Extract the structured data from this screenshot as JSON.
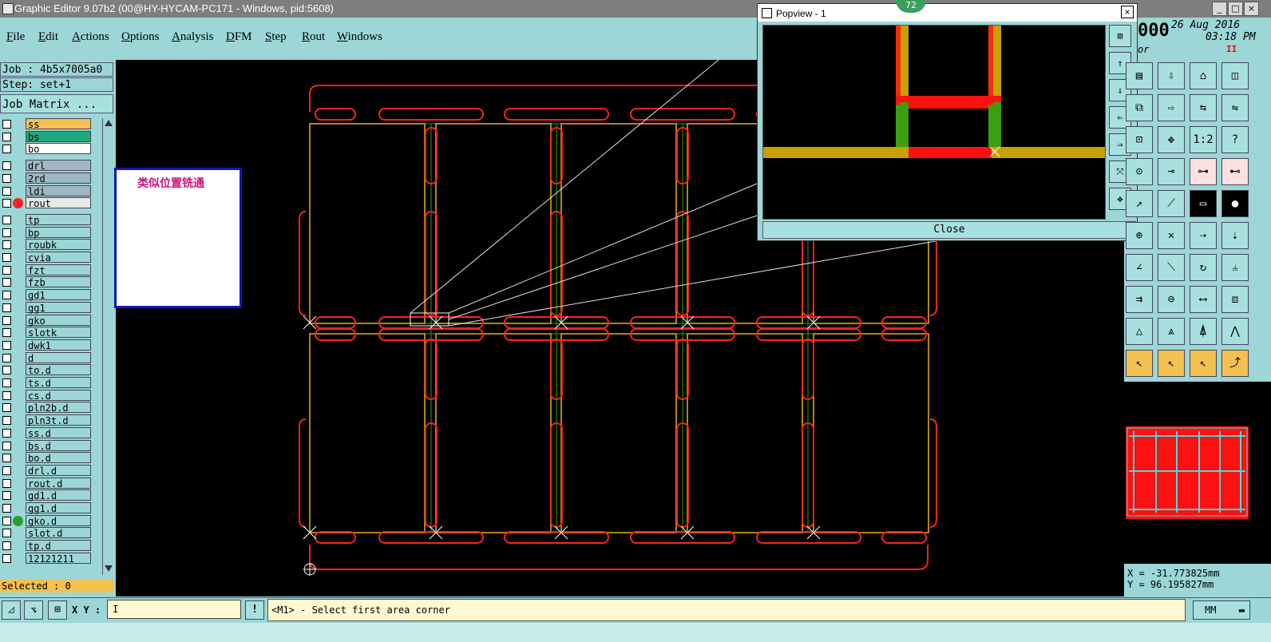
{
  "window": {
    "title": "Graphic Editor 9.07b2 (00@HY-HYCAM-PC171 - Windows, pid:5608)"
  },
  "menu": {
    "items": [
      "File",
      "Edit",
      "Actions",
      "Options",
      "Analysis",
      "DFM",
      "Step",
      "Rout",
      "Windows"
    ]
  },
  "job": {
    "label": "Job : 4b5x7005a0",
    "step": "Step: set+1",
    "matrix_button": "Job Matrix ..."
  },
  "layers": [
    {
      "name": "ss",
      "bg": "#f4c050",
      "dot": ""
    },
    {
      "name": "bs",
      "bg": "#1fa87c",
      "dot": ""
    },
    {
      "name": "bo",
      "bg": "#ffffff",
      "dot": ""
    },
    {
      "name": "drl",
      "bg": "#9fb7c2",
      "dot": ""
    },
    {
      "name": "2rd",
      "bg": "#9fb7c2",
      "dot": ""
    },
    {
      "name": "ldi",
      "bg": "#9fb7c2",
      "dot": ""
    },
    {
      "name": "rout",
      "bg": "#e8e8e8",
      "dot": "#ff2020"
    },
    {
      "name": "tp",
      "bg": "#9cd6d6",
      "dot": ""
    },
    {
      "name": "bp",
      "bg": "#9cd6d6",
      "dot": ""
    },
    {
      "name": "roubk",
      "bg": "#9cd6d6",
      "dot": ""
    },
    {
      "name": "cvia",
      "bg": "#9cd6d6",
      "dot": ""
    },
    {
      "name": "fzt",
      "bg": "#9cd6d6",
      "dot": ""
    },
    {
      "name": "fzb",
      "bg": "#9cd6d6",
      "dot": ""
    },
    {
      "name": "gd1",
      "bg": "#9cd6d6",
      "dot": ""
    },
    {
      "name": "gg1",
      "bg": "#9cd6d6",
      "dot": ""
    },
    {
      "name": "gko",
      "bg": "#9cd6d6",
      "dot": ""
    },
    {
      "name": "slotk",
      "bg": "#9cd6d6",
      "dot": ""
    },
    {
      "name": "dwk1",
      "bg": "#9cd6d6",
      "dot": ""
    },
    {
      "name": "d",
      "bg": "#9cd6d6",
      "dot": ""
    },
    {
      "name": "to.d",
      "bg": "#9cd6d6",
      "dot": ""
    },
    {
      "name": "ts.d",
      "bg": "#9cd6d6",
      "dot": ""
    },
    {
      "name": "cs.d",
      "bg": "#9cd6d6",
      "dot": ""
    },
    {
      "name": "pln2b.d",
      "bg": "#9cd6d6",
      "dot": ""
    },
    {
      "name": "pln3t.d",
      "bg": "#9cd6d6",
      "dot": ""
    },
    {
      "name": "ss.d",
      "bg": "#9cd6d6",
      "dot": ""
    },
    {
      "name": "bs.d",
      "bg": "#9cd6d6",
      "dot": ""
    },
    {
      "name": "bo.d",
      "bg": "#9cd6d6",
      "dot": ""
    },
    {
      "name": "drl.d",
      "bg": "#9cd6d6",
      "dot": ""
    },
    {
      "name": "rout.d",
      "bg": "#9cd6d6",
      "dot": ""
    },
    {
      "name": "gd1.d",
      "bg": "#9cd6d6",
      "dot": ""
    },
    {
      "name": "gg1.d",
      "bg": "#9cd6d6",
      "dot": ""
    },
    {
      "name": "gko.d",
      "bg": "#9cd6d6",
      "dot": "#28a028"
    },
    {
      "name": "slot.d",
      "bg": "#9cd6d6",
      "dot": ""
    },
    {
      "name": "tp.d",
      "bg": "#9cd6d6",
      "dot": ""
    },
    {
      "name": "12121211",
      "bg": "#9cd6d6",
      "dot": ""
    }
  ],
  "selected": "Selected : 0",
  "note": "类似位置铣通",
  "popview": {
    "title": "Popview - 1",
    "badge": "72",
    "close": "Close"
  },
  "datetime": {
    "count": "000",
    "date": "26 Aug 2016",
    "time": "03:18 PM",
    "mode": "or",
    "pause": "II"
  },
  "coords": {
    "x": "X = -31.773825mm",
    "y": "Y = 96.195827mm"
  },
  "bottom": {
    "xy_label": "X Y :",
    "xy_value": "I",
    "warn": "!",
    "status": "<M1> - Select first area corner",
    "unit": "MM"
  },
  "icons": {
    "tools": [
      "layer-icon",
      "move-icon",
      "home-icon",
      "window-icon",
      "copy-icon",
      "move-right-icon",
      "mirror-icon",
      "resize-icon",
      "snap-icon",
      "center-icon",
      "ratio-icon",
      "help-icon",
      "label-icon",
      "probe-icon",
      "net-icon",
      "net-alt-icon",
      "cursor-icon",
      "route-icon",
      "ruler-icon",
      "pad-icon",
      "drill-icon",
      "cross-icon",
      "node-icon",
      "node-alt-icon",
      "angle-icon",
      "line-icon",
      "rotate-icon",
      "align-icon",
      "connect-icon",
      "segment-icon",
      "width-icon",
      "fill-icon",
      "arc-icon",
      "arc-up-icon",
      "arc-outline-icon",
      "arc-red-icon",
      "select-icon",
      "select-alt-icon",
      "select-arrow-icon",
      "path-icon"
    ]
  }
}
